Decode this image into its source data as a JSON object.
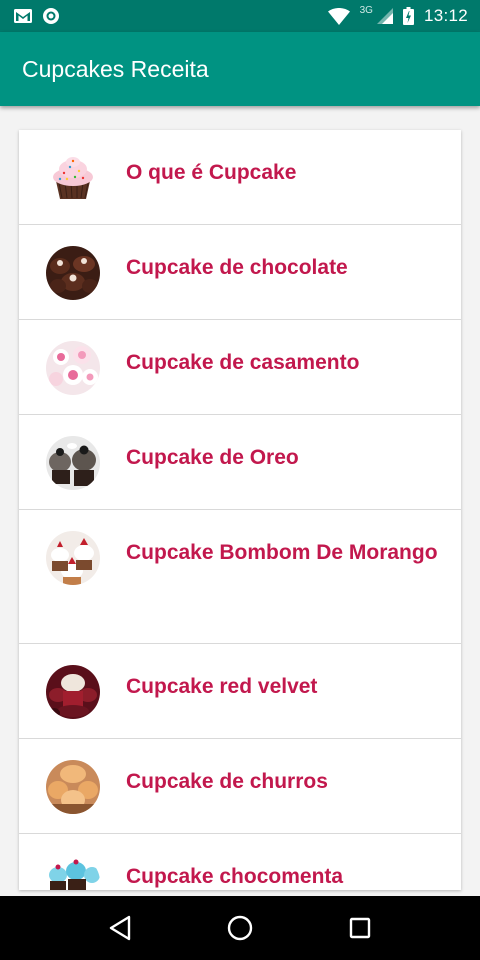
{
  "status_bar": {
    "time": "13:12",
    "network": "3G",
    "icons": [
      "gmail-icon",
      "app-notification-icon",
      "wifi-icon",
      "signal-icon",
      "battery-icon"
    ]
  },
  "app_bar": {
    "title": "Cupcakes Receita",
    "color": "#009382"
  },
  "list": {
    "text_color": "#c2184d",
    "items": [
      {
        "label": "O que é Cupcake",
        "icon": "cupcake-sprinkles-thumb"
      },
      {
        "label": "Cupcake de chocolate",
        "icon": "chocolate-cupcakes-thumb"
      },
      {
        "label": "Cupcake de casamento",
        "icon": "wedding-cupcakes-thumb"
      },
      {
        "label": "Cupcake de Oreo",
        "icon": "oreo-cupcakes-thumb"
      },
      {
        "label": "Cupcake Bombom De Morango",
        "icon": "strawberry-bonbon-cupcakes-thumb"
      },
      {
        "label": "Cupcake red velvet",
        "icon": "red-velvet-cupcakes-thumb"
      },
      {
        "label": "Cupcake de churros",
        "icon": "churros-cupcakes-thumb"
      },
      {
        "label": "Cupcake chocomenta",
        "icon": "chocomint-cupcakes-thumb"
      }
    ]
  },
  "nav_bar": {
    "buttons": [
      "back-button",
      "home-button",
      "recents-button"
    ]
  }
}
